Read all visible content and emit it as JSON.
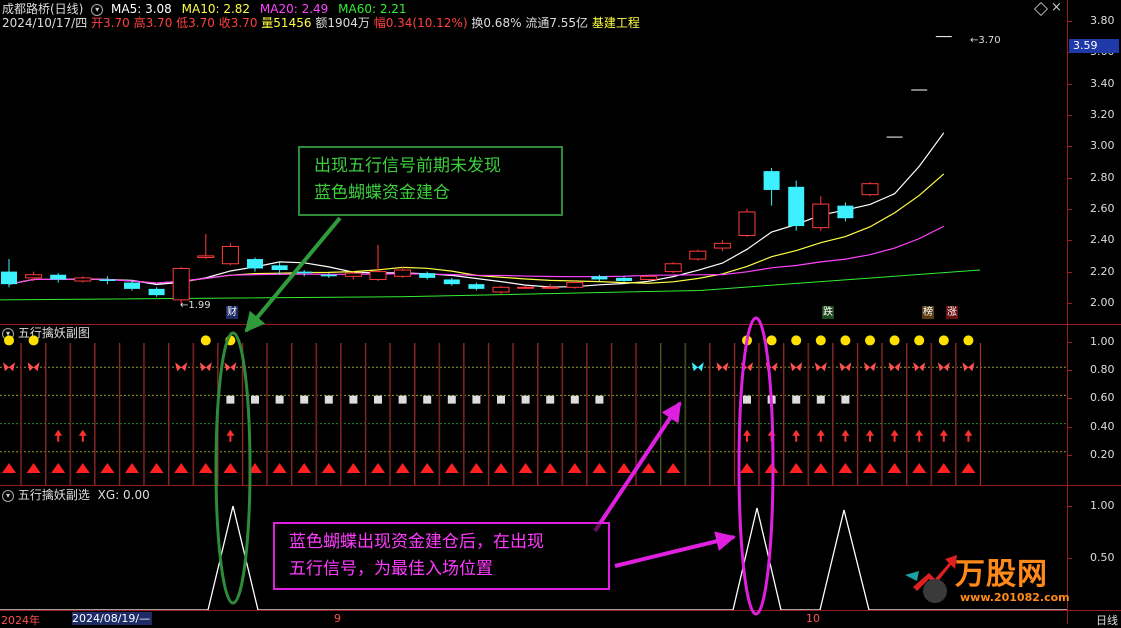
{
  "header": {
    "stock_name": "成都路桥(日线)",
    "ma5": "MA5: 3.08",
    "ma10": "MA10: 2.82",
    "ma20": "MA20: 2.49",
    "ma60": "MA60: 2.21",
    "date": "2024/10/17/四",
    "open": "开3.70",
    "high": "高3.70",
    "low": "低3.70",
    "close": "收3.70",
    "volume": "量51456",
    "amount": "额1904万",
    "change": "幅0.34(10.12%)",
    "turnover": "换0.68%",
    "float_cap": "流通7.55亿",
    "sector": "基建工程"
  },
  "main_axis": [
    "3.80",
    "3.60",
    "3.40",
    "3.20",
    "3.00",
    "2.80",
    "2.60",
    "2.40",
    "2.20",
    "2.00"
  ],
  "current_price_tag": "3.59",
  "high_label": "3.70",
  "low_label": "1.99",
  "markers": {
    "cai": "财",
    "die": "跌",
    "bang": "榜",
    "zhang": "涨"
  },
  "panel1": {
    "title": "五行擒妖副图",
    "axis": [
      "1.00",
      "0.80",
      "0.60",
      "0.40",
      "0.20"
    ]
  },
  "panel2": {
    "title": "五行擒妖副选",
    "xg": "XG: 0.00",
    "axis": [
      "1.00",
      "0.50"
    ]
  },
  "notes": {
    "green_line1": "出现五行信号前期未发现",
    "green_line2": "蓝色蝴蝶资金建仓",
    "pink_line1": "蓝色蝴蝶出现资金建仓后，在出现",
    "pink_line2": "五行信号，为最佳入场位置"
  },
  "bottom": {
    "year": "2024年",
    "date_range": "2024/08/19/—",
    "m9": "9",
    "m10": "10",
    "period": "日线"
  },
  "watermark": {
    "brand": "万股网",
    "url": "www.201082.com"
  },
  "colors": {
    "up": "#ff3b3b",
    "down": "#3cf0ff",
    "green_box": "#2e8b3a",
    "pink_box": "#e020e0"
  },
  "chart_data": {
    "type": "candlestick",
    "x_label_months": [
      "9",
      "10"
    ],
    "ylim": [
      1.95,
      3.85
    ],
    "candles_approx": [
      [
        2.2,
        2.12,
        2.28,
        2.1
      ],
      [
        2.16,
        2.18,
        2.2,
        2.14
      ],
      [
        2.18,
        2.15,
        2.19,
        2.13
      ],
      [
        2.14,
        2.16,
        2.17,
        2.13
      ],
      [
        2.15,
        2.14,
        2.17,
        2.12
      ],
      [
        2.13,
        2.09,
        2.14,
        2.08
      ],
      [
        2.09,
        2.05,
        2.1,
        2.04
      ],
      [
        2.02,
        2.22,
        2.23,
        1.99
      ],
      [
        2.29,
        2.3,
        2.44,
        2.28
      ],
      [
        2.25,
        2.36,
        2.38,
        2.24
      ],
      [
        2.28,
        2.22,
        2.29,
        2.2
      ],
      [
        2.24,
        2.21,
        2.26,
        2.18
      ],
      [
        2.2,
        2.19,
        2.21,
        2.17
      ],
      [
        2.18,
        2.17,
        2.19,
        2.16
      ],
      [
        2.17,
        2.19,
        2.2,
        2.15
      ],
      [
        2.15,
        2.2,
        2.37,
        2.14
      ],
      [
        2.17,
        2.21,
        2.23,
        2.16
      ],
      [
        2.19,
        2.16,
        2.2,
        2.15
      ],
      [
        2.15,
        2.12,
        2.16,
        2.11
      ],
      [
        2.12,
        2.09,
        2.13,
        2.08
      ],
      [
        2.07,
        2.1,
        2.11,
        2.06
      ],
      [
        2.1,
        2.1,
        2.11,
        2.09
      ],
      [
        2.1,
        2.1,
        2.12,
        2.09
      ],
      [
        2.1,
        2.13,
        2.14,
        2.09
      ],
      [
        2.17,
        2.15,
        2.18,
        2.14
      ],
      [
        2.16,
        2.14,
        2.17,
        2.13
      ],
      [
        2.15,
        2.17,
        2.18,
        2.14
      ],
      [
        2.2,
        2.25,
        2.26,
        2.19
      ],
      [
        2.28,
        2.33,
        2.34,
        2.27
      ],
      [
        2.35,
        2.38,
        2.4,
        2.33
      ],
      [
        2.43,
        2.58,
        2.6,
        2.42
      ],
      [
        2.84,
        2.72,
        2.86,
        2.62
      ],
      [
        2.74,
        2.49,
        2.78,
        2.46
      ],
      [
        2.48,
        2.63,
        2.68,
        2.46
      ],
      [
        2.62,
        2.54,
        2.64,
        2.52
      ],
      [
        2.69,
        2.76,
        2.77,
        2.68
      ],
      [
        3.06,
        3.06,
        3.06,
        3.06
      ],
      [
        3.36,
        3.36,
        3.36,
        3.36
      ],
      [
        3.7,
        3.7,
        3.7,
        3.7
      ]
    ]
  }
}
